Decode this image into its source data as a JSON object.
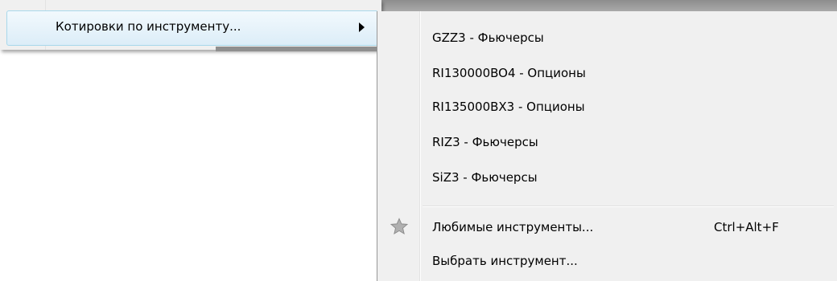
{
  "parent_menu": {
    "item_label": "Котировки по инструменту..."
  },
  "submenu": {
    "instruments": [
      {
        "label": "GZZ3 - Фьючерсы"
      },
      {
        "label": "RI130000BO4 - Опционы"
      },
      {
        "label": "RI135000BX3 - Опционы"
      },
      {
        "label": "RIZ3 - Фьючерсы"
      },
      {
        "label": "SiZ3 - Фьючерсы"
      }
    ],
    "favorites": {
      "label": "Любимые инструменты...",
      "shortcut": "Ctrl+Alt+F",
      "icon": "star-icon"
    },
    "choose": {
      "label": "Выбрать инструмент..."
    }
  },
  "colors": {
    "menu_bg": "#f0f0f0",
    "highlight_border": "#a8d8eb",
    "highlight_top": "#f2f9fd",
    "highlight_bottom": "#dcedf8",
    "star_gray": "#9a9a9a"
  }
}
